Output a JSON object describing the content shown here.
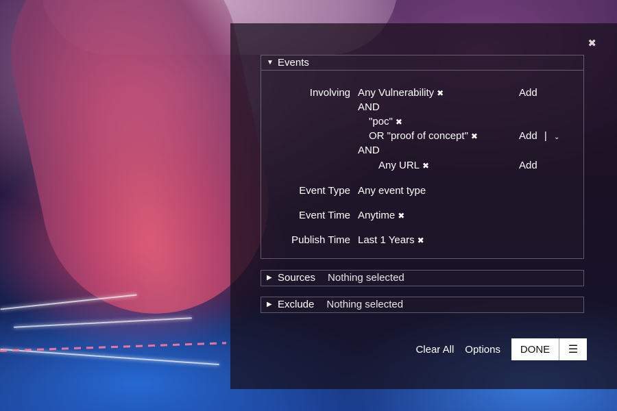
{
  "panel": {
    "close_icon": "✖"
  },
  "events": {
    "title": "Events",
    "involving": {
      "label": "Involving",
      "first": "Any Vulnerability",
      "and1": "AND",
      "term1": "\"poc\"",
      "term2": "OR \"proof of concept\"",
      "and2": "AND",
      "url": "Any URL",
      "add": "Add",
      "add_separator": "|"
    },
    "event_type": {
      "label": "Event Type",
      "value": "Any event type"
    },
    "event_time": {
      "label": "Event Time",
      "value": "Anytime"
    },
    "publish_time": {
      "label": "Publish Time",
      "value": "Last 1 Years"
    }
  },
  "sources": {
    "title": "Sources",
    "summary": "Nothing selected"
  },
  "exclude": {
    "title": "Exclude",
    "summary": "Nothing selected"
  },
  "footer": {
    "clear_all": "Clear All",
    "options": "Options",
    "done": "DONE"
  },
  "icons": {
    "remove": "✖",
    "caret_down": "▼",
    "caret_right": "▶",
    "chevron_down": "⌄",
    "list": "☰"
  },
  "colors": {
    "panel_bg": "#160e1a",
    "text": "#ffffff",
    "button_bg": "#ffffff"
  }
}
